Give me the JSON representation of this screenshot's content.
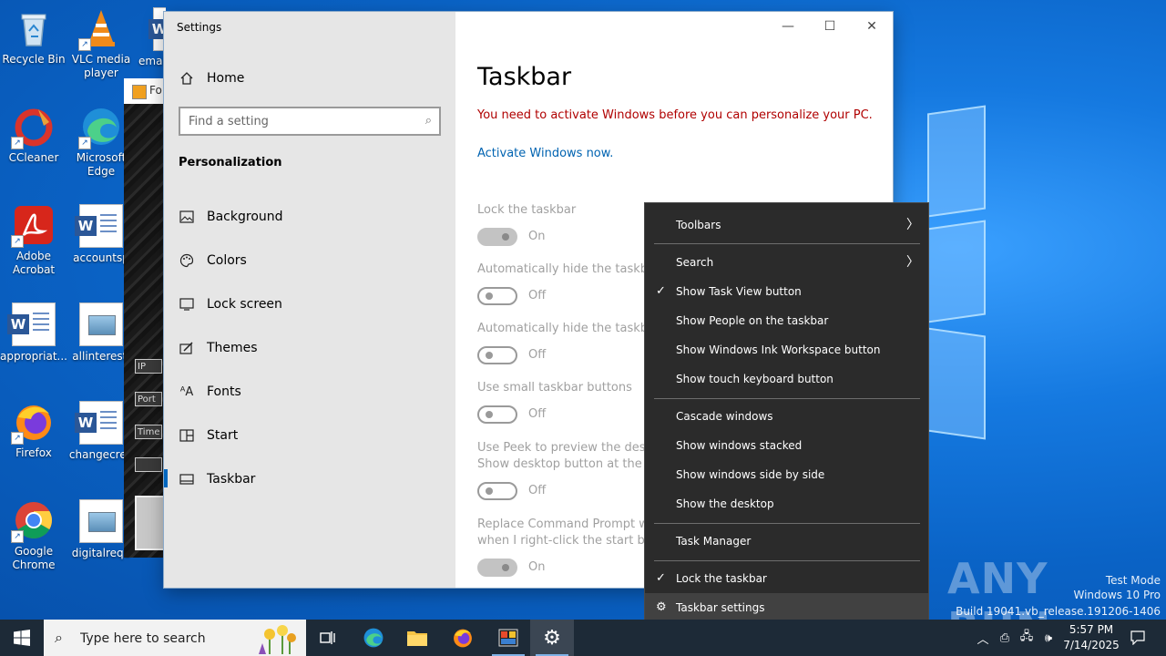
{
  "desktop": {
    "icons": [
      {
        "label": "Recycle Bin"
      },
      {
        "label": "VLC media player"
      },
      {
        "label": "email"
      },
      {
        "label": "CCleaner"
      },
      {
        "label": "Microsoft Edge"
      },
      {
        "label": "Adobe Acrobat"
      },
      {
        "label": "accountsp"
      },
      {
        "label": "appropriat..."
      },
      {
        "label": "allinteresti"
      },
      {
        "label": "Firefox"
      },
      {
        "label": "changecrea"
      },
      {
        "label": "Google Chrome"
      },
      {
        "label": "digitalrequ"
      }
    ],
    "background_window": {
      "title": "Fo",
      "fields": [
        "IP",
        "Port",
        "Time"
      ]
    }
  },
  "settings": {
    "window_title": "Settings",
    "controls": {
      "minimize": "—",
      "maximize": "☐",
      "close": "✕"
    },
    "nav": {
      "home": "Home",
      "search_placeholder": "Find a setting",
      "section": "Personalization",
      "items": [
        {
          "label": "Background",
          "icon": "image-icon"
        },
        {
          "label": "Colors",
          "icon": "palette-icon"
        },
        {
          "label": "Lock screen",
          "icon": "monitor-icon"
        },
        {
          "label": "Themes",
          "icon": "brush-icon"
        },
        {
          "label": "Fonts",
          "icon": "font-icon"
        },
        {
          "label": "Start",
          "icon": "start-icon"
        },
        {
          "label": "Taskbar",
          "icon": "taskbar-icon",
          "selected": true
        }
      ]
    },
    "page": {
      "title": "Taskbar",
      "warning": "You need to activate Windows before you can personalize your PC.",
      "activate_link": "Activate Windows now.",
      "settings": [
        {
          "label": "Lock the taskbar",
          "state": "On"
        },
        {
          "label": "Automatically hide the taskbar",
          "state": "Off"
        },
        {
          "label": "Automatically hide the taskbar",
          "state": "Off"
        },
        {
          "label": "Use small taskbar buttons",
          "state": "Off"
        },
        {
          "label": "Use Peek to preview the deskt",
          "label2": "Show desktop button at the e",
          "state": "Off"
        },
        {
          "label": "Replace Command Prompt wi",
          "label2": "when I right-click the start bu",
          "state": "On"
        }
      ]
    }
  },
  "context_menu": {
    "items": [
      {
        "label": "Toolbars",
        "submenu": true
      },
      {
        "label": "Search",
        "submenu": true
      },
      {
        "label": "Show Task View button",
        "checked": true
      },
      {
        "label": "Show People on the taskbar"
      },
      {
        "label": "Show Windows Ink Workspace button"
      },
      {
        "label": "Show touch keyboard button"
      },
      {
        "label": "Cascade windows"
      },
      {
        "label": "Show windows stacked"
      },
      {
        "label": "Show windows side by side"
      },
      {
        "label": "Show the desktop"
      },
      {
        "label": "Task Manager"
      },
      {
        "label": "Lock the taskbar",
        "checked": true
      },
      {
        "label": "Taskbar settings",
        "icon": "gear-icon",
        "highlighted": true
      }
    ]
  },
  "watermark": {
    "brand": "ANY RUN",
    "line1": "Test Mode",
    "line2": "Windows 10 Pro",
    "line3": "Build 19041.vb_release.191206-1406"
  },
  "taskbar": {
    "search_placeholder": "Type here to search",
    "time": "5:57 PM",
    "date": "7/14/2025"
  },
  "colors": {
    "accent": "#0067c0",
    "warning": "#b00000",
    "link": "#0063b1",
    "menu_bg": "#2b2b2b",
    "taskbar_bg": "#1d2a37"
  }
}
